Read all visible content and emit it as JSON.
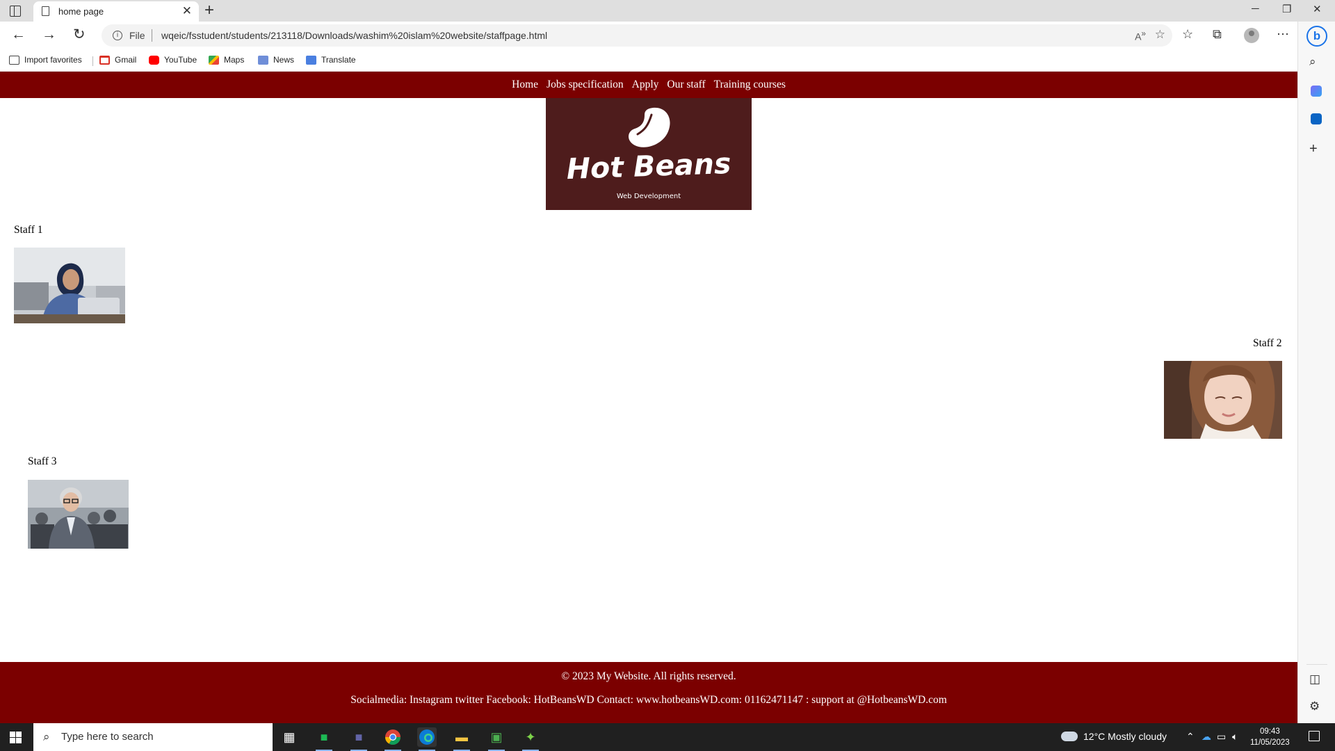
{
  "browser": {
    "tab_title": "home page",
    "address_scheme": "File",
    "url": "wqeic/fsstudent/students/213118/Downloads/washim%20islam%20website/staffpage.html",
    "bookmarks": [
      {
        "label": "Import favorites",
        "icon": "import-icon"
      },
      {
        "label": "Gmail",
        "icon": "gmail-icon"
      },
      {
        "label": "YouTube",
        "icon": "youtube-icon"
      },
      {
        "label": "Maps",
        "icon": "maps-icon"
      },
      {
        "label": "News",
        "icon": "news-icon"
      },
      {
        "label": "Translate",
        "icon": "translate-icon"
      }
    ]
  },
  "site": {
    "nav": [
      "Home",
      "Jobs specification",
      "Apply",
      "Our staff",
      "Training courses"
    ],
    "logo": {
      "title": "Hot Beans",
      "subtitle": "Web Development"
    },
    "staff": [
      {
        "label": "Staff 1"
      },
      {
        "label": "Staff 2"
      },
      {
        "label": "Staff 3"
      }
    ],
    "footer": {
      "copyright": "© 2023 My Website. All rights reserved.",
      "contact": "Socialmedia: Instagram twitter Facebook: HotBeansWD Contact: www.hotbeansWD.com: 01162471147 : support at @HotbeansWD.com"
    },
    "colors": {
      "brand": "#7b0000",
      "logo_bg": "#4e1c1c"
    }
  },
  "taskbar": {
    "search_placeholder": "Type here to search",
    "weather": "12°C  Mostly cloudy",
    "time": "09:43",
    "date": "11/05/2023"
  }
}
